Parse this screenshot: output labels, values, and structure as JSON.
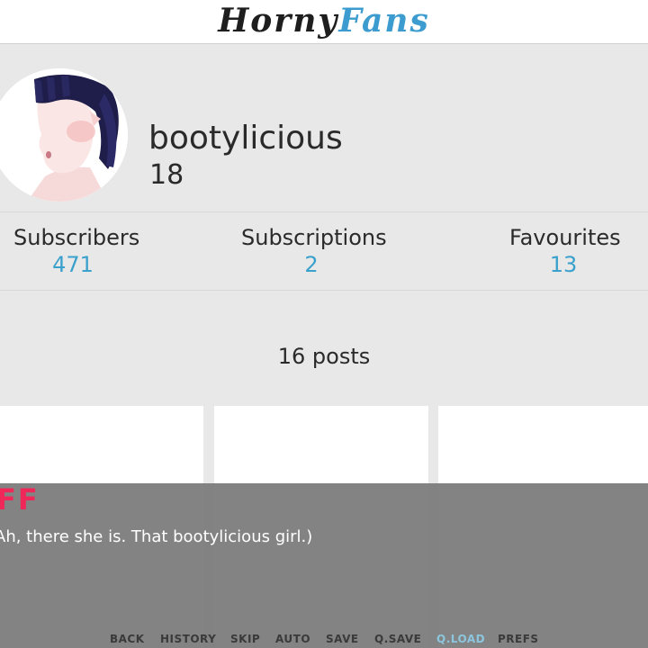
{
  "header": {
    "logo_part1": "Horny",
    "logo_part2": "Fans"
  },
  "profile": {
    "username": "bootylicious",
    "age": "18"
  },
  "stats": [
    {
      "label": "Subscribers",
      "value": "471"
    },
    {
      "label": "Subscriptions",
      "value": "2"
    },
    {
      "label": "Favourites",
      "value": "13"
    }
  ],
  "posts": {
    "count_label": "16 posts"
  },
  "dialogue": {
    "speaker": "FF",
    "text": "Ah, there she is. That bootylicious girl.)"
  },
  "quick_menu": {
    "items": [
      "BACK",
      "HISTORY",
      "SKIP",
      "AUTO",
      "SAVE",
      "Q.SAVE",
      "Q.LOAD",
      "PREFS"
    ],
    "active": "Q.LOAD"
  },
  "colors": {
    "accent": "#3aa0cc",
    "speaker": "#f0285a",
    "background": "#e8e8e8"
  }
}
